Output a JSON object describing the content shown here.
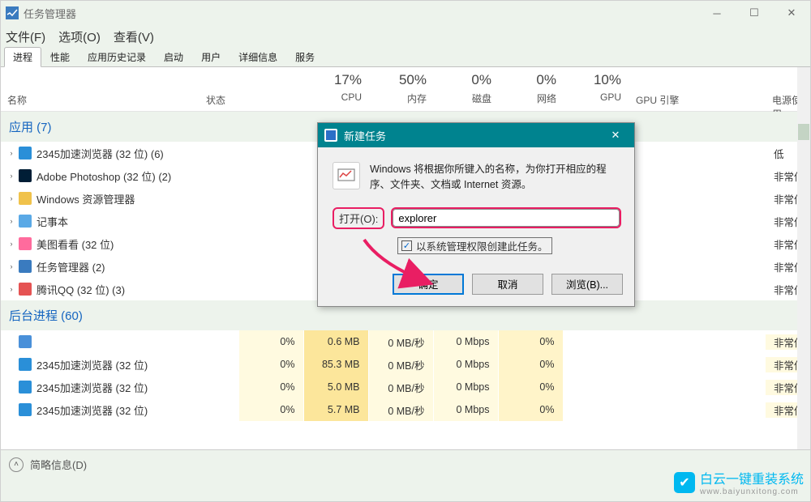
{
  "window": {
    "title": "任务管理器"
  },
  "menu": {
    "file": "文件(F)",
    "options": "选项(O)",
    "view": "查看(V)"
  },
  "tabs": [
    "进程",
    "性能",
    "应用历史记录",
    "启动",
    "用户",
    "详细信息",
    "服务"
  ],
  "columns": {
    "name": "名称",
    "status": "状态",
    "cpu": {
      "pct": "17%",
      "label": "CPU"
    },
    "mem": {
      "pct": "50%",
      "label": "内存"
    },
    "disk": {
      "pct": "0%",
      "label": "磁盘"
    },
    "net": {
      "pct": "0%",
      "label": "网络"
    },
    "gpu": {
      "pct": "10%",
      "label": "GPU"
    },
    "gpu_engine": "GPU 引擎",
    "power": "电源使用"
  },
  "groups": {
    "apps": {
      "title": "应用 (7)",
      "items": [
        {
          "name": "2345加速浏览器 (32 位) (6)",
          "icon": "ie",
          "power": "低"
        },
        {
          "name": "Adobe Photoshop (32 位) (2)",
          "icon": "ps",
          "power": "非常低"
        },
        {
          "name": "Windows 资源管理器",
          "icon": "win",
          "power": "非常低"
        },
        {
          "name": "记事本",
          "icon": "note",
          "power": "非常低"
        },
        {
          "name": "美图看看 (32 位)",
          "icon": "mt",
          "power": "非常低"
        },
        {
          "name": "任务管理器 (2)",
          "icon": "tm",
          "power": "非常低"
        },
        {
          "name": "腾讯QQ (32 位) (3)",
          "icon": "qq",
          "power": "非常低"
        }
      ]
    },
    "bg": {
      "title": "后台进程 (60)",
      "items": [
        {
          "name": "",
          "icon": "cog",
          "cpu": "0%",
          "mem": "0.6 MB",
          "disk": "0 MB/秒",
          "net": "0 Mbps",
          "gpu": "0%",
          "power": "非常低"
        },
        {
          "name": "2345加速浏览器 (32 位)",
          "icon": "ie",
          "cpu": "0%",
          "mem": "85.3 MB",
          "disk": "0 MB/秒",
          "net": "0 Mbps",
          "gpu": "0%",
          "power": "非常低"
        },
        {
          "name": "2345加速浏览器 (32 位)",
          "icon": "ie",
          "cpu": "0%",
          "mem": "5.0 MB",
          "disk": "0 MB/秒",
          "net": "0 Mbps",
          "gpu": "0%",
          "power": "非常低"
        },
        {
          "name": "2345加速浏览器 (32 位)",
          "icon": "ie",
          "cpu": "0%",
          "mem": "5.7 MB",
          "disk": "0 MB/秒",
          "net": "0 Mbps",
          "gpu": "0%",
          "power": "非常低"
        }
      ]
    }
  },
  "footer": {
    "simple": "简略信息(D)"
  },
  "dialog": {
    "title": "新建任务",
    "msg": "Windows 将根据你所键入的名称，为你打开相应的程序、文件夹、文档或 Internet 资源。",
    "open_label": "打开(O):",
    "input_value": "explorer",
    "admin": "以系统管理权限创建此任务。",
    "ok": "确定",
    "cancel": "取消",
    "browse": "浏览(B)..."
  },
  "watermark": {
    "text": "白云一键重装系统",
    "sub": "www.baiyunxitong.com"
  }
}
